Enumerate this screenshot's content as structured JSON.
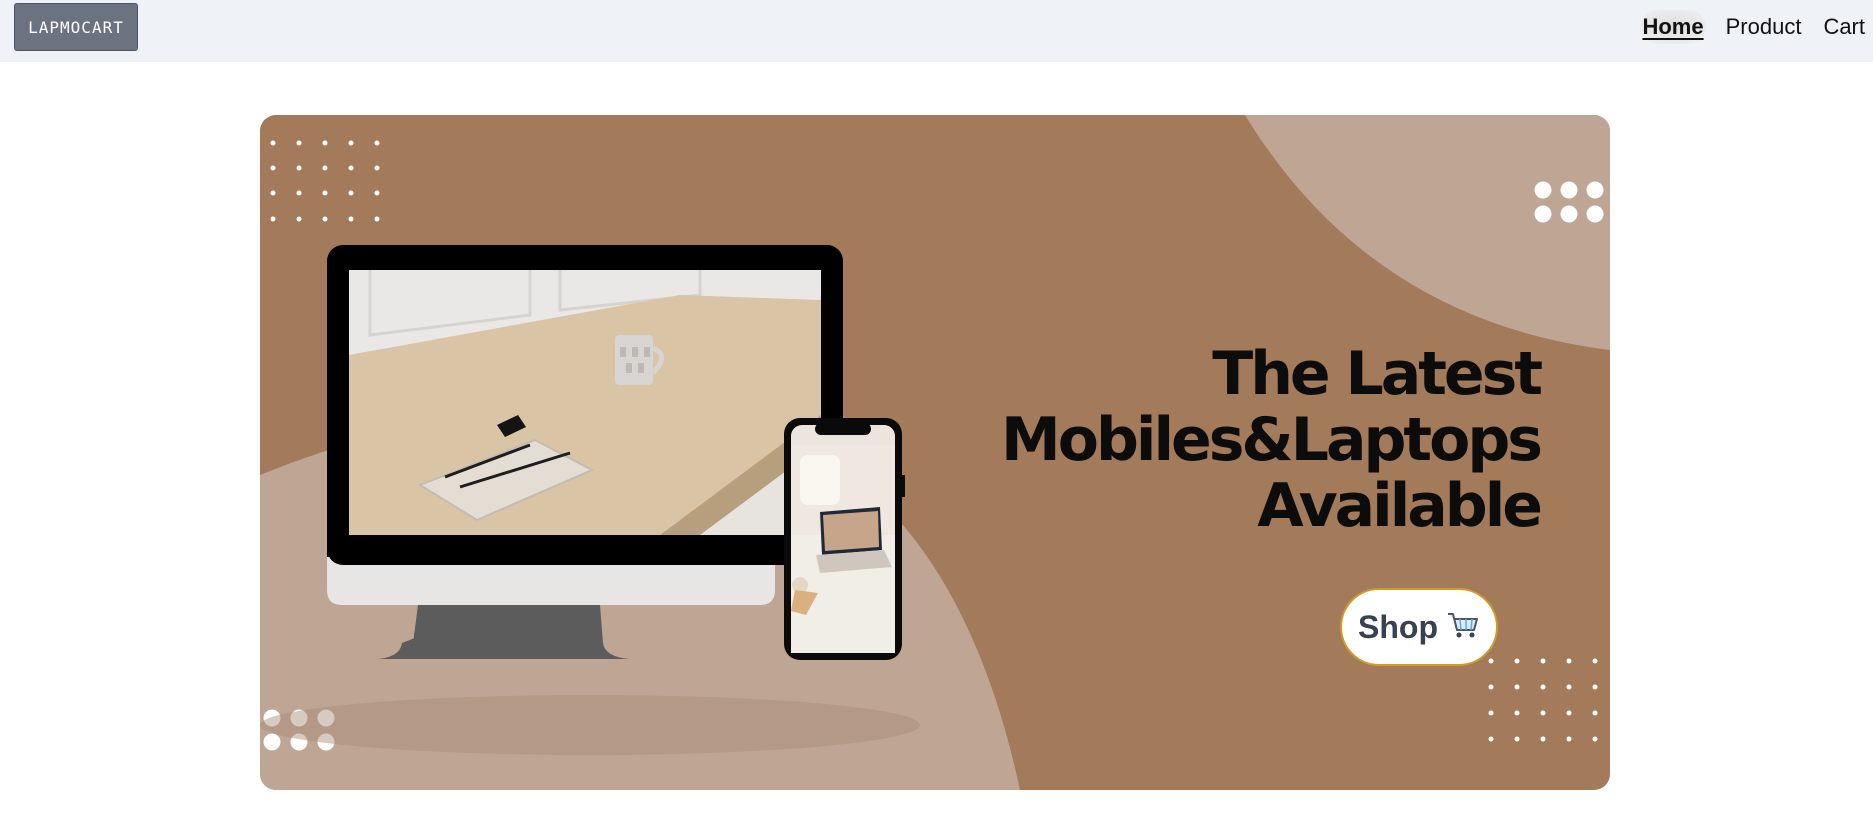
{
  "navbar": {
    "brand": "LAPMOCART",
    "links": [
      "Home",
      "Product",
      "Cart"
    ],
    "active": "Home"
  },
  "hero": {
    "headline": [
      "The Latest",
      "Mobiles&Laptops",
      "Available"
    ],
    "shop_button": {
      "label": "Shop",
      "icon": "shopping-cart-icon"
    },
    "colors": {
      "background": "#a37a5a",
      "accent_shape": "#bfa694",
      "headline": "#0c0c0c",
      "button_border": "#d19a2b"
    },
    "images": {
      "monitor_screen": "desk-with-notebook-and-mug-photo",
      "phone_screen": "laptop-on-sofa-photo"
    }
  },
  "colors": {
    "navbar_bg": "#eff2f7",
    "brand_bg": "#6b7280"
  }
}
